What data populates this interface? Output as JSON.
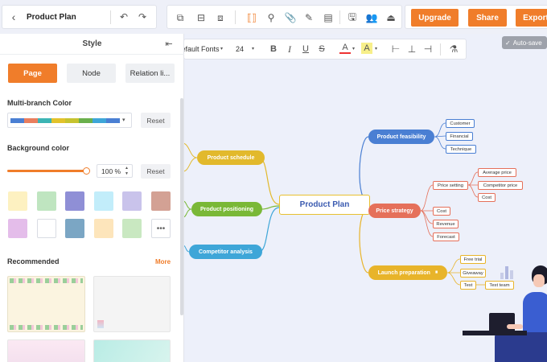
{
  "header": {
    "title": "Product Plan",
    "upgrade": "Upgrade",
    "share": "Share",
    "export": "Export",
    "autosave": "Auto-save"
  },
  "format": {
    "font": "Default Fonts",
    "size": "24"
  },
  "panel": {
    "title": "Style",
    "tabs": [
      "Page",
      "Node",
      "Relation li..."
    ],
    "multi_branch": "Multi-branch Color",
    "reset": "Reset",
    "bg_color": "Background color",
    "opacity": "100 %",
    "recommended": "Recommended",
    "more": "More",
    "branch_colors": [
      "#4a7fd3",
      "#e97e5e",
      "#3cb4b4",
      "#e2c22b",
      "#c6c32f",
      "#6ab04c",
      "#3ea6d8",
      "#4a7fd3"
    ],
    "swatches": [
      "#fdf1c1",
      "#bfe5c0",
      "#8f8fd6",
      "#c2edfa",
      "#c9c3eb",
      "#d3a194",
      "#e4bdea",
      "#ffffff",
      "#7ba6c4",
      "#fde5bb",
      "#c9e8c1"
    ]
  },
  "mindmap": {
    "center": "Product Plan",
    "left": [
      "Product schedule",
      "Product positioning",
      "Competitor analysis"
    ],
    "feasibility": {
      "label": "Product feasibility",
      "children": [
        "Customer",
        "Financial",
        "Technique"
      ]
    },
    "price": {
      "label": "Price strategy",
      "setting": "Price setting",
      "setting_children": [
        "Average price",
        "Competitor price",
        "Cost"
      ],
      "children": [
        "Cost",
        "Revenue",
        "Forecast"
      ]
    },
    "launch": {
      "label": "Launch preparation",
      "children": [
        "Free trial",
        "Giveaway",
        "Test"
      ],
      "test_team": "Test team"
    }
  }
}
